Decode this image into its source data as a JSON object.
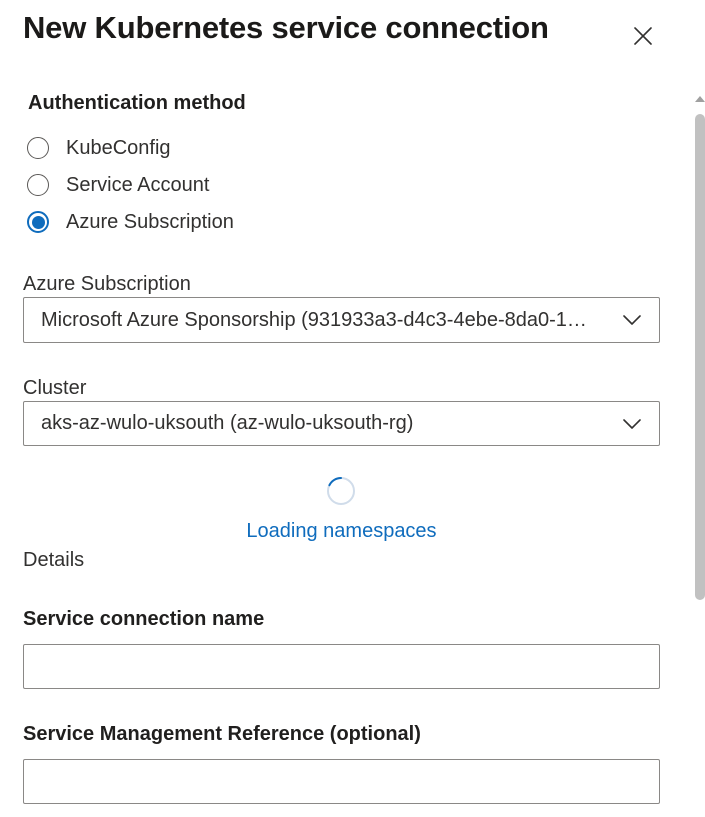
{
  "dialog": {
    "title": "New Kubernetes service connection",
    "close_icon": "close-icon"
  },
  "auth": {
    "label": "Authentication method",
    "options": [
      {
        "label": "KubeConfig",
        "selected": false
      },
      {
        "label": "Service Account",
        "selected": false
      },
      {
        "label": "Azure Subscription",
        "selected": true
      }
    ]
  },
  "subscription": {
    "label": "Azure Subscription",
    "value": "Microsoft Azure Sponsorship (931933a3-d4c3-4ebe-8da0-1…",
    "icon": "chevron-down-icon"
  },
  "cluster": {
    "label": "Cluster",
    "value": "aks-az-wulo-uksouth (az-wulo-uksouth-rg)",
    "icon": "chevron-down-icon"
  },
  "namespaces": {
    "loading_text": "Loading namespaces",
    "icon": "spinner-icon"
  },
  "details": {
    "heading": "Details",
    "connection_name_label": "Service connection name",
    "connection_name_value": "",
    "smr_label": "Service Management Reference (optional)",
    "smr_value": ""
  },
  "colors": {
    "accent": "#0f6cbd",
    "border": "#8a8886",
    "text": "#323130",
    "scrollbar": "#c1c1c1"
  }
}
